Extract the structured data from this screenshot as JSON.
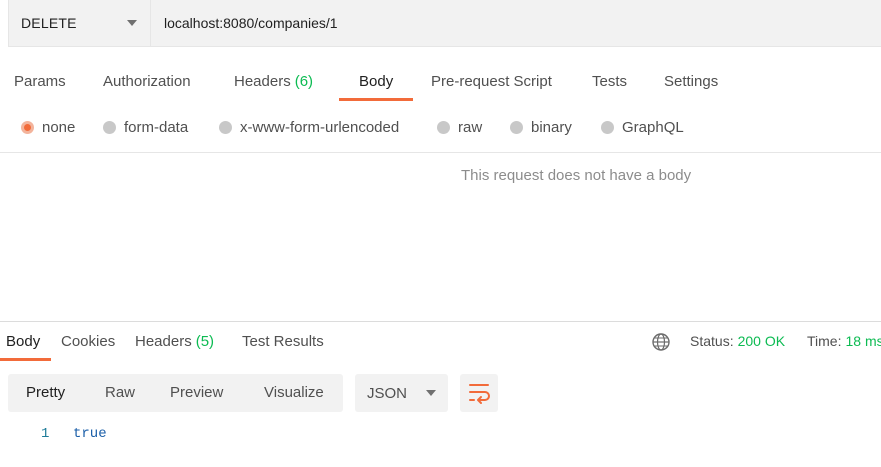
{
  "request": {
    "method": "DELETE",
    "url": "localhost:8080/companies/1"
  },
  "request_tabs": [
    {
      "label": "Params"
    },
    {
      "label": "Authorization"
    },
    {
      "label": "Headers",
      "count": "(6)"
    },
    {
      "label": "Body"
    },
    {
      "label": "Pre-request Script"
    },
    {
      "label": "Tests"
    },
    {
      "label": "Settings"
    }
  ],
  "active_request_tab": "Body",
  "body_types": [
    "none",
    "form-data",
    "x-www-form-urlencoded",
    "raw",
    "binary",
    "GraphQL"
  ],
  "selected_body_type": "none",
  "empty_body_message": "This request does not have a body",
  "response": {
    "tabs": [
      {
        "label": "Body"
      },
      {
        "label": "Cookies"
      },
      {
        "label": "Headers",
        "count": "(5)"
      },
      {
        "label": "Test Results"
      }
    ],
    "active_tab": "Body",
    "status_label": "Status:",
    "status_value": "200 OK",
    "time_label": "Time:",
    "time_value": "18 ms",
    "format_tabs": [
      "Pretty",
      "Raw",
      "Preview",
      "Visualize"
    ],
    "active_format": "Pretty",
    "language": "JSON",
    "code_lines": [
      {
        "number": "1",
        "text": "true"
      }
    ]
  },
  "icons": {
    "globe": "globe-icon",
    "wrap": "wrap-lines-icon"
  },
  "colors": {
    "accent": "#f26b3a",
    "success": "#0cbb52",
    "code_text": "#1a5ea8",
    "line_number": "#1f7c99"
  }
}
